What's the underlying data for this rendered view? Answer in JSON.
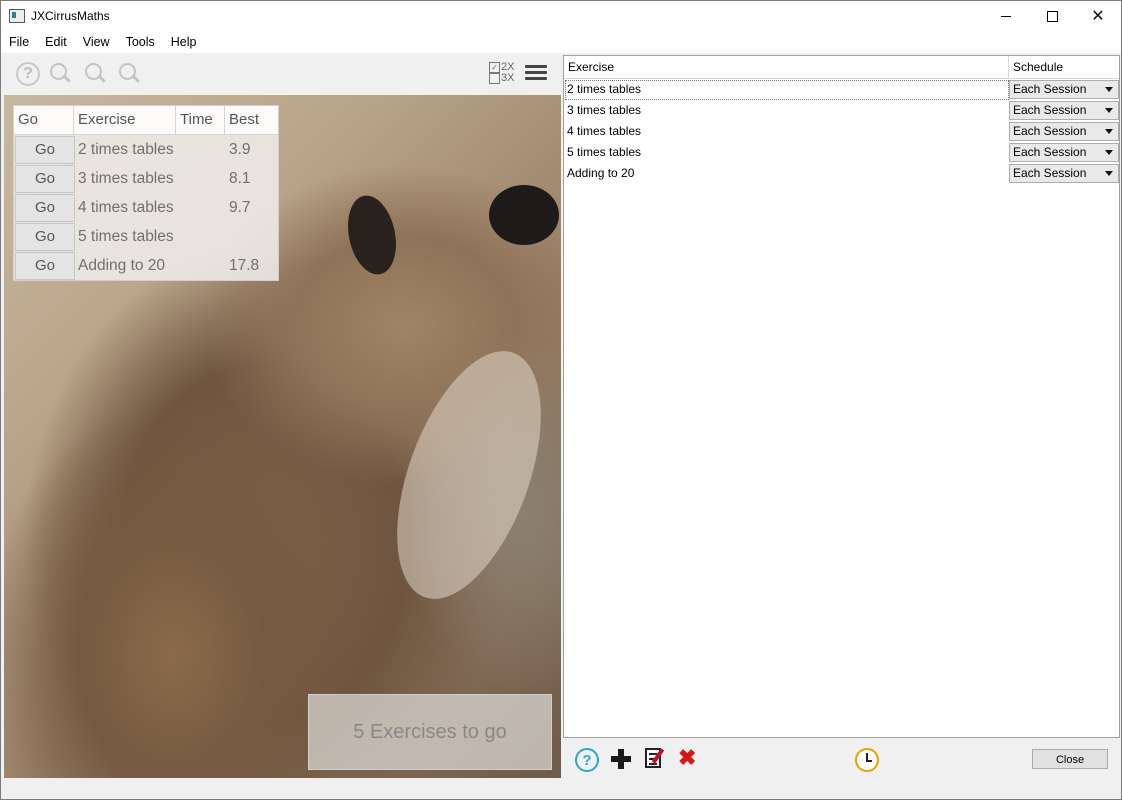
{
  "window": {
    "title": "JXCirrusMaths"
  },
  "menu": [
    "File",
    "Edit",
    "View",
    "Tools",
    "Help"
  ],
  "toolbar": {
    "icons": [
      "help-icon",
      "zoom-icon",
      "zoom-icon",
      "zoom-icon",
      "checklist-icon",
      "hamburger-menu-icon"
    ],
    "checklist": {
      "row1": "2X",
      "row2": "3X"
    }
  },
  "exercise_table": {
    "headers": {
      "go": "Go",
      "exercise": "Exercise",
      "time": "Time",
      "best": "Best"
    },
    "rows": [
      {
        "go": "Go",
        "exercise": "2 times tables",
        "time": "",
        "best": "3.9"
      },
      {
        "go": "Go",
        "exercise": "3 times tables",
        "time": "",
        "best": "8.1"
      },
      {
        "go": "Go",
        "exercise": "4 times tables",
        "time": "",
        "best": "9.7"
      },
      {
        "go": "Go",
        "exercise": "5 times tables",
        "time": "",
        "best": ""
      },
      {
        "go": "Go",
        "exercise": "Adding to 20",
        "time": "",
        "best": "17.8"
      }
    ]
  },
  "status": {
    "text": "5 Exercises to go"
  },
  "schedule_table": {
    "headers": {
      "exercise": "Exercise",
      "schedule": "Schedule"
    },
    "rows": [
      {
        "exercise": "2 times tables",
        "schedule": "Each Session"
      },
      {
        "exercise": "3 times tables",
        "schedule": "Each Session"
      },
      {
        "exercise": "4 times tables",
        "schedule": "Each Session"
      },
      {
        "exercise": "5 times tables",
        "schedule": "Each Session"
      },
      {
        "exercise": "Adding to 20",
        "schedule": "Each Session"
      }
    ]
  },
  "bottom_toolbar": {
    "icons": [
      "help-icon",
      "add-icon",
      "edit-icon",
      "delete-icon",
      "clock-icon"
    ],
    "close_label": "Close"
  },
  "colors": {
    "help_accent": "#2aa8c8",
    "delete_red": "#d41818",
    "clock_orange": "#e8a000"
  }
}
